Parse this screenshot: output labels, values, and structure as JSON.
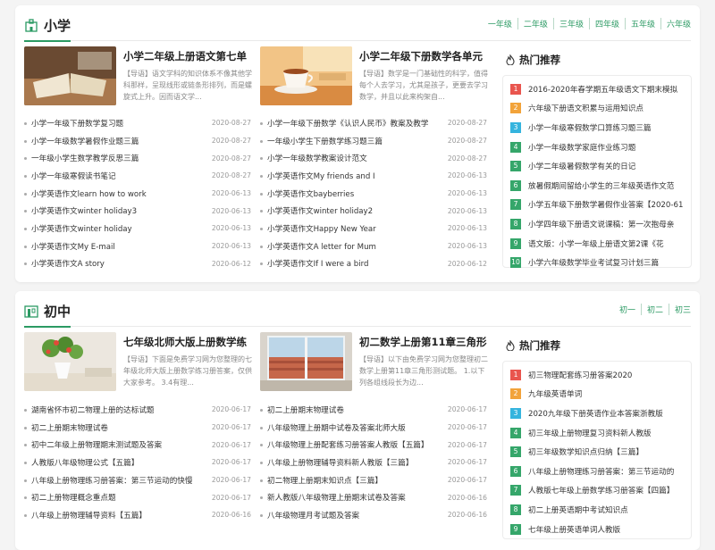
{
  "colors": {
    "accent": "#2b9a63",
    "rank1": "#e9554e",
    "rank2": "#f2a33a",
    "rank3": "#35b4de",
    "rankN": "#35a66a"
  },
  "sections": [
    {
      "title": "小学",
      "grades": [
        "一年级",
        "二年级",
        "三年级",
        "四年级",
        "五年级",
        "六年级"
      ],
      "features": [
        {
          "title": "小学二年级上册语文第七单",
          "desc": "【导语】语文学科的知识体系不像其他学科那样，呈现线形或链条形排列，而是螺旋式上升。因而语文学..."
        },
        {
          "title": "小学二年级下册数学各单元",
          "desc": "【导语】数学是一门基础性的科学，值得每个人去学习，尤其是孩子，更要去学习数学，并且以此来构架自..."
        }
      ],
      "left": [
        {
          "t": "小学一年级下册数学复习题",
          "d": "2020-08-27"
        },
        {
          "t": "小学一年级数学暑假作业题三篇",
          "d": "2020-08-27"
        },
        {
          "t": "一年级小学生数学教学反思三篇",
          "d": "2020-08-27"
        },
        {
          "t": "小学一年级寒假读书笔记",
          "d": "2020-08-27"
        },
        {
          "t": "小学英语作文learn how to work",
          "d": "2020-06-13"
        },
        {
          "t": "小学英语作文winter holiday3",
          "d": "2020-06-13"
        },
        {
          "t": "小学英语作文winter holiday",
          "d": "2020-06-13"
        },
        {
          "t": "小学英语作文My E-mail",
          "d": "2020-06-13"
        },
        {
          "t": "小学英语作文A story",
          "d": "2020-06-12"
        }
      ],
      "mid": [
        {
          "t": "小学一年级下册数学《认识人民币》教案及教学",
          "d": "2020-08-27"
        },
        {
          "t": "一年级小学生下册数学练习题三篇",
          "d": "2020-08-27"
        },
        {
          "t": "小学一年级数学教案设计范文",
          "d": "2020-08-27"
        },
        {
          "t": "小学英语作文My friends and I",
          "d": "2020-06-13"
        },
        {
          "t": "小学英语作文bayberries",
          "d": "2020-06-13"
        },
        {
          "t": "小学英语作文winter holiday2",
          "d": "2020-06-13"
        },
        {
          "t": "小学英语作文Happy New Year",
          "d": "2020-06-13"
        },
        {
          "t": "小学英语作文A letter for Mum",
          "d": "2020-06-13"
        },
        {
          "t": "小学英语作文If I were a bird",
          "d": "2020-06-12"
        }
      ],
      "hot_title": "热门推荐",
      "hot": [
        "2016-2020年春学期五年级语文下期末模拟",
        "六年级下册语文积累与运用知识点",
        "小学一年级寒假数学口算练习题三篇",
        "小学一年级数学家庭作业练习题",
        "小学二年级暑假数学有关的日记",
        "放暑假期间留给小学生的三年级英语作文范",
        "小学五年级下册数学暑假作业答案【2020-61",
        "小学四年级下册语文说课稿：第一次抱母亲",
        "语文版：小学一年级上册语文第2课《花",
        "小学六年级数学毕业考试复习计划三篇"
      ]
    },
    {
      "title": "初中",
      "grades": [
        "初一",
        "初二",
        "初三"
      ],
      "features": [
        {
          "title": "七年级北师大版上册数学练",
          "desc": "【导语】下面是免费学习网为您整理的七年级北师大版上册数学练习册答案，仅供大家参考。    3.4有理..."
        },
        {
          "title": "初二数学上册第11章三角形",
          "desc": "【导语】以下由免费学习网为您整理初二数学上册第11章三角形测试题。    1.以下列各组线段长为边..."
        }
      ],
      "left": [
        {
          "t": "湖南省怀市初二物理上册的达标试题",
          "d": "2020-06-17"
        },
        {
          "t": "初二上册期末物理试卷",
          "d": "2020-06-17"
        },
        {
          "t": "初中二年级上册物理期末测试题及答案",
          "d": "2020-06-17"
        },
        {
          "t": "人教版八年级物理公式【五篇】",
          "d": "2020-06-17"
        },
        {
          "t": "八年级上册物理练习册答案：第三节运动的快慢",
          "d": "2020-06-17"
        },
        {
          "t": "初二上册物理概念重点题",
          "d": "2020-06-17"
        },
        {
          "t": "八年级上册物理辅导资料【五篇】",
          "d": "2020-06-16"
        }
      ],
      "mid": [
        {
          "t": "初二上册期末物理试卷",
          "d": "2020-06-17"
        },
        {
          "t": "八年级物理上册期中试卷及答案北师大版",
          "d": "2020-06-17"
        },
        {
          "t": "八年级物理上册配套练习册答案人教版【五篇】",
          "d": "2020-06-17"
        },
        {
          "t": "八年级上册物理辅导资料新人教版【三篇】",
          "d": "2020-06-17"
        },
        {
          "t": "初二物理上册期末知识点【三篇】",
          "d": "2020-06-17"
        },
        {
          "t": "新人教版八年级物理上册期末试卷及答案",
          "d": "2020-06-16"
        },
        {
          "t": "八年级物理月考试题及答案",
          "d": "2020-06-16"
        }
      ],
      "hot_title": "热门推荐",
      "hot": [
        "初三物理配套练习册答案2020",
        "九年级英语单词",
        "2020九年级下册英语作业本答案浙教版",
        "初三年级上册物理复习资料新人教版",
        "初三年级数学知识点归纳【三篇】",
        "八年级上册物理练习册答案：第三节运动的",
        "人教版七年级上册数学练习册答案【四篇】",
        "初二上册英语期中考试知识点",
        "七年级上册英语单词人教版"
      ]
    }
  ]
}
